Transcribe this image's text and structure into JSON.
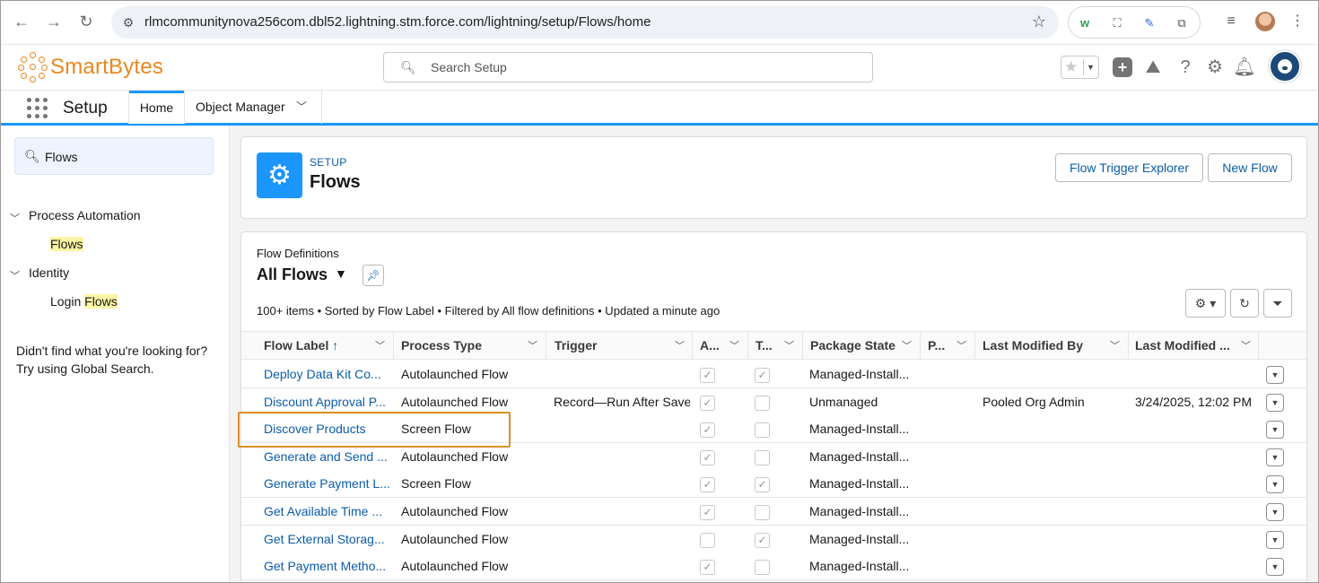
{
  "browser": {
    "url": "rlmcommunitynova256com.dbl52.lightning.stm.force.com/lightning/setup/Flows/home"
  },
  "global_header": {
    "logo_text": "SmartBytes",
    "search_placeholder": "Search Setup"
  },
  "context_nav": {
    "app_name": "Setup",
    "tabs": [
      {
        "label": "Home",
        "active": true
      },
      {
        "label": "Object Manager",
        "active": false
      }
    ]
  },
  "sidebar": {
    "quick_find_value": "Flows",
    "sections": [
      {
        "label": "Process Automation",
        "items": [
          {
            "prefix": "",
            "match": "Flows"
          }
        ]
      },
      {
        "label": "Identity",
        "items": [
          {
            "prefix": "Login ",
            "match": "Flows"
          }
        ]
      }
    ],
    "help_line1": "Didn't find what you're looking for?",
    "help_line2": "Try using Global Search."
  },
  "page_header": {
    "eyebrow": "SETUP",
    "title": "Flows",
    "buttons": {
      "trigger_explorer": "Flow Trigger Explorer",
      "new_flow": "New Flow"
    }
  },
  "list_view": {
    "eyebrow": "Flow Definitions",
    "title": "All Flows",
    "meta": "100+ items • Sorted by Flow Label • Filtered by All flow definitions • Updated a minute ago",
    "columns": [
      "Flow Label",
      "Process Type",
      "Trigger",
      "A...",
      "T...",
      "Package State",
      "P...",
      "Last Modified By",
      "Last Modified ..."
    ],
    "sort_indicator": "↑",
    "rows": [
      {
        "label": "Deploy Data Kit Co...",
        "process_type": "Autolaunched Flow",
        "trigger": "",
        "active": true,
        "template": true,
        "package_state": "Managed-Install...",
        "modified_by": "",
        "modified_date": ""
      },
      {
        "label": "Discount Approval P...",
        "process_type": "Autolaunched Flow",
        "trigger": "Record—Run After Save",
        "active": true,
        "template": false,
        "package_state": "Unmanaged",
        "modified_by": "Pooled Org Admin",
        "modified_date": "3/24/2025, 12:02 PM"
      },
      {
        "label": "Discover Products",
        "process_type": "Screen Flow",
        "trigger": "",
        "active": true,
        "template": false,
        "package_state": "Managed-Install...",
        "modified_by": "",
        "modified_date": ""
      },
      {
        "label": "Generate and Send ...",
        "process_type": "Autolaunched Flow",
        "trigger": "",
        "active": true,
        "template": false,
        "package_state": "Managed-Install...",
        "modified_by": "",
        "modified_date": ""
      },
      {
        "label": "Generate Payment L...",
        "process_type": "Screen Flow",
        "trigger": "",
        "active": true,
        "template": true,
        "package_state": "Managed-Install...",
        "modified_by": "",
        "modified_date": ""
      },
      {
        "label": "Get Available Time ...",
        "process_type": "Autolaunched Flow",
        "trigger": "",
        "active": true,
        "template": false,
        "package_state": "Managed-Install...",
        "modified_by": "",
        "modified_date": ""
      },
      {
        "label": "Get External Storag...",
        "process_type": "Autolaunched Flow",
        "trigger": "",
        "active": false,
        "template": true,
        "package_state": "Managed-Install...",
        "modified_by": "",
        "modified_date": ""
      },
      {
        "label": "Get Payment Metho...",
        "process_type": "Autolaunched Flow",
        "trigger": "",
        "active": true,
        "template": false,
        "package_state": "Managed-Install...",
        "modified_by": "",
        "modified_date": ""
      }
    ]
  },
  "colors": {
    "brand_orange": "#e8881e",
    "link_blue": "#0b5cab",
    "accent_blue": "#1b96ff",
    "highlight_border": "#d98f2b",
    "search_highlight": "#fbf6a6"
  }
}
